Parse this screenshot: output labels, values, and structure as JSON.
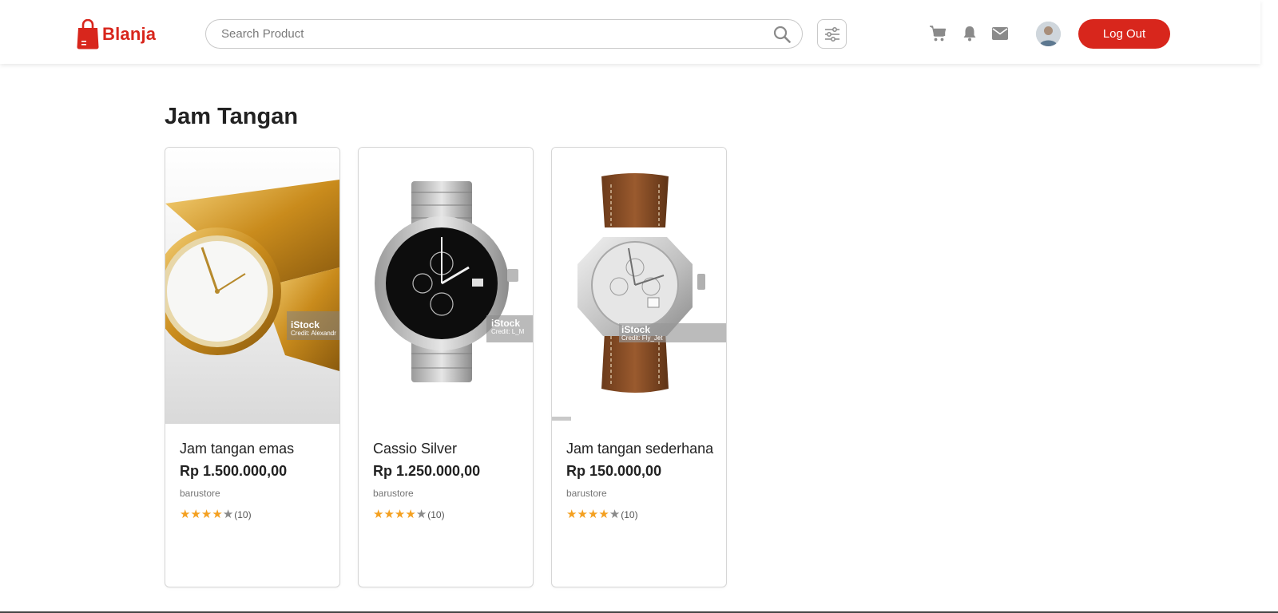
{
  "header": {
    "logo_text": "Blanja",
    "search_placeholder": "Search Product",
    "logout_label": "Log Out"
  },
  "icons": {
    "logo": "shopping-bag-icon",
    "search": "search-icon",
    "filter": "sliders-icon",
    "cart": "cart-icon",
    "notifications": "bell-icon",
    "messages": "mail-icon"
  },
  "colors": {
    "brand": "#d8261c",
    "star": "#f4a020",
    "star_empty": "#8a8a8a",
    "icon_gray": "#8a8a8a"
  },
  "page": {
    "title": "Jam Tangan"
  },
  "products": [
    {
      "name": "Jam tangan emas",
      "price": "Rp 1.500.000,00",
      "store": "barustore",
      "rating": 4,
      "rating_max": 5,
      "rating_count": "(10)",
      "watermark": "iStock",
      "watermark_credit": "Credit: Alexandr"
    },
    {
      "name": "Cassio Silver",
      "price": "Rp 1.250.000,00",
      "store": "barustore",
      "rating": 4,
      "rating_max": 5,
      "rating_count": "(10)",
      "watermark": "iStock",
      "watermark_credit": "Credit: L_M"
    },
    {
      "name": "Jam tangan sederhana",
      "price": "Rp 150.000,00",
      "store": "barustore",
      "rating": 4,
      "rating_max": 5,
      "rating_count": "(10)",
      "watermark": "iStock",
      "watermark_credit": "Credit: Fly_Jet"
    }
  ]
}
